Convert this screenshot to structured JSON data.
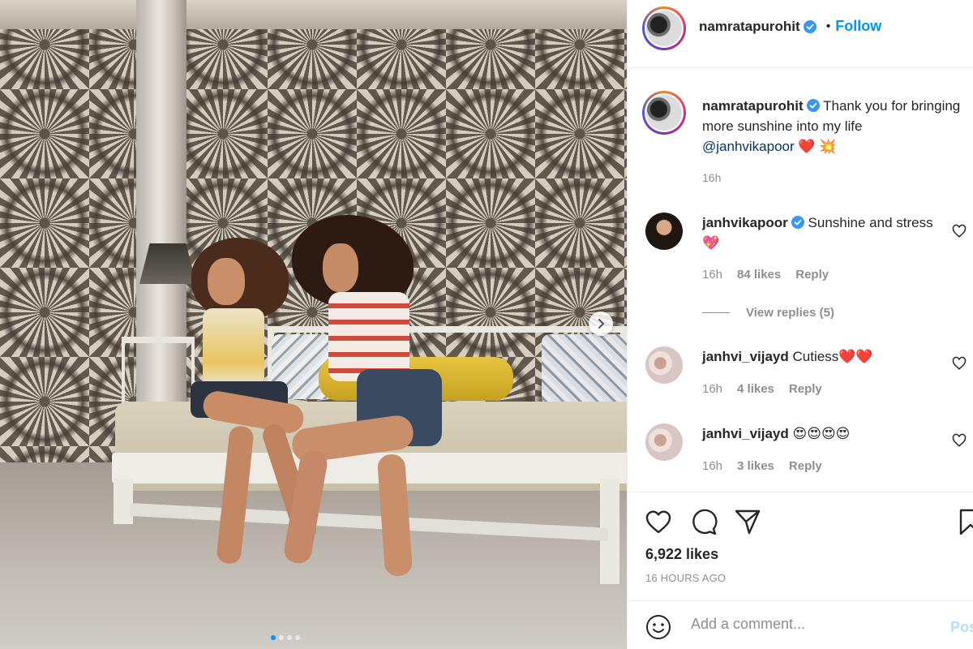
{
  "post": {
    "photo_description_icon": "photo",
    "carousel": {
      "total_dots": 4,
      "active_index": 0
    }
  },
  "header": {
    "username": "namratapurohit",
    "dot": "•",
    "follow_label": "Follow"
  },
  "caption": {
    "username": "namratapurohit",
    "text": "Thank you for bringing more sunshine into my life",
    "mention": "@janhvikapoor",
    "emojis": "❤️ 💥",
    "time": "16h"
  },
  "comments": [
    {
      "username": "janhvikapoor",
      "verified": true,
      "text": "Sunshine and stress",
      "emoji": "💖",
      "time": "16h",
      "likes": "84 likes",
      "reply_label": "Reply"
    },
    {
      "username": "janhvi_vijayd",
      "verified": false,
      "text": "Cutiess",
      "emoji": "❤️❤️",
      "time": "16h",
      "likes": "4 likes",
      "reply_label": "Reply"
    },
    {
      "username": "janhvi_vijayd",
      "verified": false,
      "text": "",
      "emoji": "😍😍😍😍",
      "time": "16h",
      "likes": "3 likes",
      "reply_label": "Reply"
    }
  ],
  "view_replies": "View replies (5)",
  "stats": {
    "likes": "6,922 likes",
    "posted": "16 HOURS AGO"
  },
  "add_comment": {
    "placeholder": "Add a comment...",
    "post_label": "Post"
  },
  "colors": {
    "follow_blue": "#0095f6",
    "verified_blue": "#3897f0",
    "mention": "#00376b",
    "muted": "#8e8e8e"
  },
  "icons": [
    "heart-icon",
    "comment-icon",
    "share-icon",
    "bookmark-icon",
    "emoji-icon",
    "verified-icon",
    "chevron-right-icon"
  ]
}
